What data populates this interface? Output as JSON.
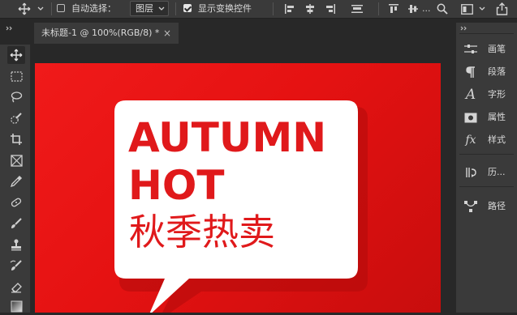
{
  "options_bar": {
    "auto_select_label": "自动选择：",
    "auto_select_checked": false,
    "auto_select_target": "图层",
    "show_transform_label": "显示变换控件",
    "show_transform_checked": true,
    "extra_menu": "..."
  },
  "document": {
    "tab_title": "未标题-1 @ 100%(RGB/8) *",
    "close_glyph": "×"
  },
  "artwork": {
    "headline_line1": "AUTUMN",
    "headline_line2": "HOT",
    "subtitle": "秋季热卖",
    "background_color": "#e41313",
    "text_color": "#e0191b",
    "bubble_color": "#ffffff"
  },
  "tools": [
    {
      "name": "move-tool",
      "icon": "move-icon",
      "active": true
    },
    {
      "name": "marquee-tool",
      "icon": "marquee-icon",
      "active": false
    },
    {
      "name": "lasso-tool",
      "icon": "lasso-icon",
      "active": false
    },
    {
      "name": "quick-select-tool",
      "icon": "quick-select-icon",
      "active": false
    },
    {
      "name": "crop-tool",
      "icon": "crop-icon",
      "active": false
    },
    {
      "name": "frame-tool",
      "icon": "frame-icon",
      "active": false
    },
    {
      "name": "eyedropper-tool",
      "icon": "eyedropper-icon",
      "active": false
    },
    {
      "name": "healing-brush-tool",
      "icon": "bandage-icon",
      "active": false
    },
    {
      "name": "brush-tool",
      "icon": "brush-icon",
      "active": false
    },
    {
      "name": "clone-stamp-tool",
      "icon": "stamp-icon",
      "active": false
    },
    {
      "name": "history-brush-tool",
      "icon": "history-brush-icon",
      "active": false
    },
    {
      "name": "eraser-tool",
      "icon": "eraser-icon",
      "active": false
    },
    {
      "name": "gradient-tool",
      "icon": "gradient-icon",
      "active": false
    }
  ],
  "panels": [
    {
      "label": "画笔",
      "icon": "brush-settings-icon"
    },
    {
      "label": "段落",
      "icon": "paragraph-icon"
    },
    {
      "label": "字形",
      "icon": "glyph-icon"
    },
    {
      "label": "属性",
      "icon": "properties-icon"
    },
    {
      "label": "样式",
      "icon": "styles-icon"
    },
    {
      "label": "历...",
      "icon": "history-icon"
    },
    {
      "label": "路径",
      "icon": "paths-icon"
    }
  ]
}
